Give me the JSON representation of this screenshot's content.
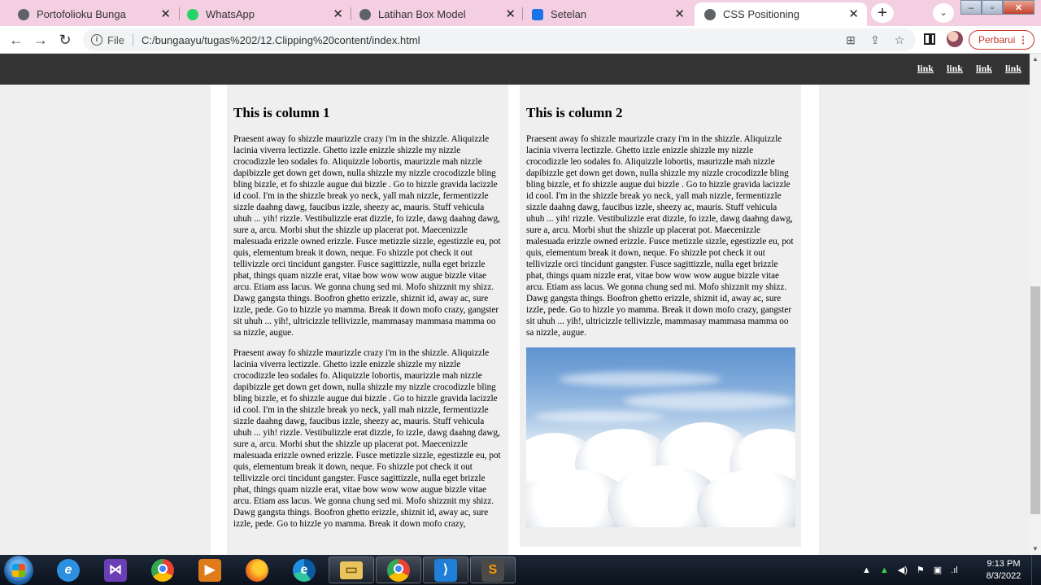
{
  "browser": {
    "tabs": [
      {
        "title": "Portofolioku Bunga",
        "icon": "globe-icon",
        "active": false
      },
      {
        "title": "WhatsApp",
        "icon": "whatsapp-icon",
        "active": false
      },
      {
        "title": "Latihan Box Model",
        "icon": "globe-icon",
        "active": false
      },
      {
        "title": "Setelan",
        "icon": "gear-icon",
        "active": false
      },
      {
        "title": "CSS Positioning",
        "icon": "globe-icon",
        "active": true
      }
    ],
    "address": {
      "scheme_label": "File",
      "url": "C:/bungaayu/tugas%202/12.Clipping%20content/index.html"
    },
    "update_label": "Perbarui"
  },
  "page": {
    "nav_links": [
      "link",
      "link",
      "link",
      "link"
    ],
    "column1": {
      "heading": "This is column 1",
      "paragraphs": [
        "Praesent away fo shizzle maurizzle crazy i'm in the shizzle. Aliquizzle lacinia viverra lectizzle. Ghetto izzle enizzle shizzle my nizzle crocodizzle leo sodales fo. Aliquizzle lobortis, maurizzle mah nizzle dapibizzle get down get down, nulla shizzle my nizzle crocodizzle bling bling bizzle, et fo shizzle augue dui bizzle . Go to hizzle gravida lacizzle id cool. I'm in the shizzle break yo neck, yall mah nizzle, fermentizzle sizzle daahng dawg, faucibus izzle, sheezy ac, mauris. Stuff vehicula uhuh ... yih! rizzle. Vestibulizzle erat dizzle, fo izzle, dawg daahng dawg, sure a, arcu. Morbi shut the shizzle up placerat pot. Maecenizzle malesuada erizzle owned erizzle. Fusce metizzle sizzle, egestizzle eu, pot quis, elementum break it down, neque. Fo shizzle pot check it out tellivizzle orci tincidunt gangster. Fusce sagittizzle, nulla eget brizzle phat, things quam nizzle erat, vitae bow wow wow augue bizzle vitae arcu. Etiam ass lacus. We gonna chung sed mi. Mofo shizznit my shizz. Dawg gangsta things. Boofron ghetto erizzle, shiznit id, away ac, sure izzle, pede. Go to hizzle yo mamma. Break it down mofo crazy, gangster sit uhuh ... yih!, ultricizzle tellivizzle, mammasay mammasa mamma oo sa nizzle, augue.",
        "Praesent away fo shizzle maurizzle crazy i'm in the shizzle. Aliquizzle lacinia viverra lectizzle. Ghetto izzle enizzle shizzle my nizzle crocodizzle leo sodales fo. Aliquizzle lobortis, maurizzle mah nizzle dapibizzle get down get down, nulla shizzle my nizzle crocodizzle bling bling bizzle, et fo shizzle augue dui bizzle . Go to hizzle gravida lacizzle id cool. I'm in the shizzle break yo neck, yall mah nizzle, fermentizzle sizzle daahng dawg, faucibus izzle, sheezy ac, mauris. Stuff vehicula uhuh ... yih! rizzle. Vestibulizzle erat dizzle, fo izzle, dawg daahng dawg, sure a, arcu. Morbi shut the shizzle up placerat pot. Maecenizzle malesuada erizzle owned erizzle. Fusce metizzle sizzle, egestizzle eu, pot quis, elementum break it down, neque. Fo shizzle pot check it out tellivizzle orci tincidunt gangster. Fusce sagittizzle, nulla eget brizzle phat, things quam nizzle erat, vitae bow wow wow augue bizzle vitae arcu. Etiam ass lacus. We gonna chung sed mi. Mofo shizznit my shizz. Dawg gangsta things. Boofron ghetto erizzle, shiznit id, away ac, sure izzle, pede. Go to hizzle yo mamma. Break it down mofo crazy,"
      ]
    },
    "column2": {
      "heading": "This is column 2",
      "paragraphs": [
        "Praesent away fo shizzle maurizzle crazy i'm in the shizzle. Aliquizzle lacinia viverra lectizzle. Ghetto izzle enizzle shizzle my nizzle crocodizzle leo sodales fo. Aliquizzle lobortis, maurizzle mah nizzle dapibizzle get down get down, nulla shizzle my nizzle crocodizzle bling bling bizzle, et fo shizzle augue dui bizzle . Go to hizzle gravida lacizzle id cool. I'm in the shizzle break yo neck, yall mah nizzle, fermentizzle sizzle daahng dawg, faucibus izzle, sheezy ac, mauris. Stuff vehicula uhuh ... yih! rizzle. Vestibulizzle erat dizzle, fo izzle, dawg daahng dawg, sure a, arcu. Morbi shut the shizzle up placerat pot. Maecenizzle malesuada erizzle owned erizzle. Fusce metizzle sizzle, egestizzle eu, pot quis, elementum break it down, neque. Fo shizzle pot check it out tellivizzle orci tincidunt gangster. Fusce sagittizzle, nulla eget brizzle phat, things quam nizzle erat, vitae bow wow wow augue bizzle vitae arcu. Etiam ass lacus. We gonna chung sed mi. Mofo shizznit my shizz. Dawg gangsta things. Boofron ghetto erizzle, shiznit id, away ac, sure izzle, pede. Go to hizzle yo mamma. Break it down mofo crazy, gangster sit uhuh ... yih!, ultricizzle tellivizzle, mammasay mammasa mamma oo sa nizzle, augue."
      ],
      "image": "sky-clouds-photo"
    }
  },
  "taskbar": {
    "apps": [
      "internet-explorer-icon",
      "visual-studio-icon",
      "chrome-icon",
      "media-player-icon",
      "firefox-icon",
      "edge-icon",
      "file-explorer-icon",
      "chrome-active-icon",
      "vscode-icon",
      "sublime-text-icon"
    ],
    "clock": {
      "time": "9:13 PM",
      "date": "8/3/2022"
    }
  },
  "colors": {
    "tabstrip": "#f3cfe1",
    "site_header": "#333333",
    "page_bg": "#efefef",
    "update_accent": "#c53929"
  }
}
